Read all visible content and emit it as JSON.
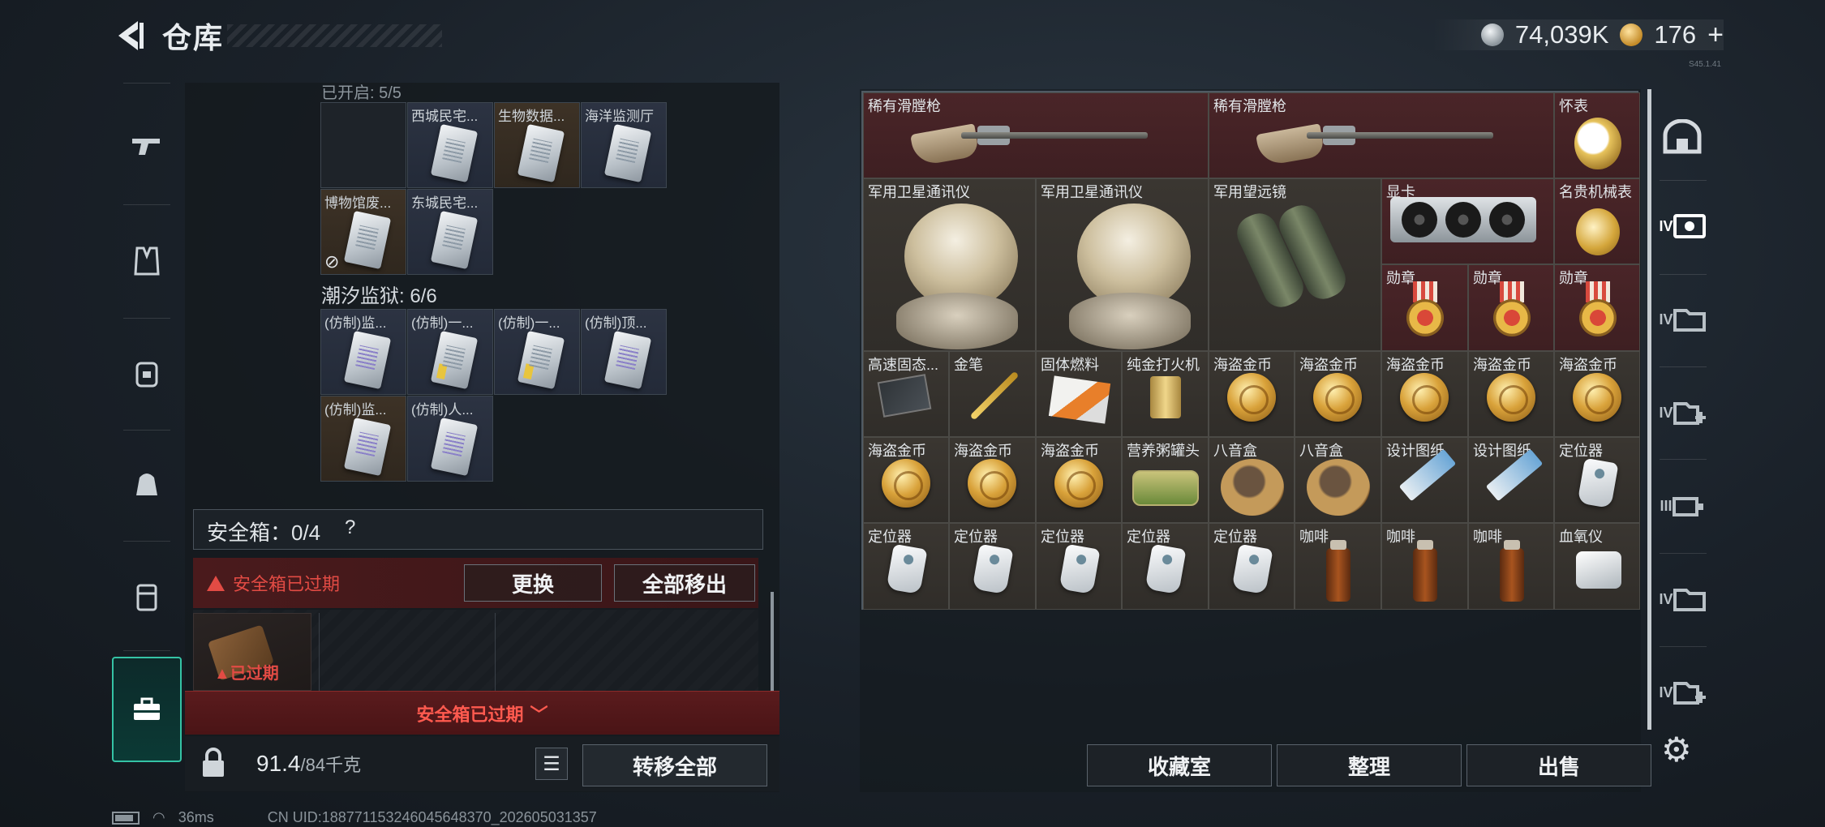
{
  "header": {
    "title": "仓库",
    "silver_amount": "74,039K",
    "gold_amount": "176",
    "gold_add": "+",
    "version_text": "S45.1.41"
  },
  "left_sidebar": {
    "icons": [
      "pistol-icon",
      "vest-icon",
      "backpack-icon",
      "bag-icon",
      "armor-icon",
      "safe-box-icon"
    ],
    "active": "safe-box-icon"
  },
  "left_panel": {
    "cut_label": "已开启: 5/5",
    "group1": [
      {
        "label": "",
        "style": "dark"
      },
      {
        "label": "西城民宅...",
        "style": "blue"
      },
      {
        "label": "生物数据...",
        "style": "brown"
      },
      {
        "label": "海洋监测厅",
        "style": "blue"
      },
      {
        "label": "博物馆废...",
        "style": "brown"
      },
      {
        "label": "东城民宅...",
        "style": "blue"
      }
    ],
    "prison_label": "潮汐监狱: 6/6",
    "group2": [
      {
        "label": "(仿制)监...",
        "style": "blue"
      },
      {
        "label": "(仿制)一...",
        "style": "blue"
      },
      {
        "label": "(仿制)一...",
        "style": "blue"
      },
      {
        "label": "(仿制)顶...",
        "style": "blue"
      },
      {
        "label": "(仿制)监...",
        "style": "brown"
      },
      {
        "label": "(仿制)人...",
        "style": "blue"
      }
    ],
    "safe_box_label": "安全箱：0/4",
    "safe_help": "?",
    "expired_warning": "安全箱已过期",
    "replace_button": "更换",
    "remove_all_button": "全部移出",
    "slot_expired": "已过期",
    "expired_banner": "安全箱已过期",
    "weight_current": "91.4",
    "weight_max": "/84千克",
    "transfer_all": "转移全部"
  },
  "status_bar": {
    "ping": "36ms",
    "uid": "CN UID:188771153246045648370_202605031357"
  },
  "inventory": {
    "rows": [
      [
        "稀有滑膛枪",
        "稀有滑膛枪",
        "怀表"
      ],
      [
        "军用卫星通讯仪",
        "军用卫星通讯仪",
        "军用望远镜",
        "显卡",
        "名贵机械表"
      ],
      [
        "勋章",
        "勋章",
        "勋章"
      ],
      [
        "高速固态...",
        "金笔",
        "固体燃料",
        "纯金打火机",
        "海盗金币",
        "海盗金币",
        "海盗金币",
        "海盗金币",
        "海盗金币"
      ],
      [
        "海盗金币",
        "海盗金币",
        "海盗金币",
        "营养粥罐头",
        "八音盒",
        "八音盒",
        "设计图纸",
        "设计图纸",
        "定位器"
      ],
      [
        "定位器",
        "定位器",
        "定位器",
        "定位器",
        "定位器",
        "咖啡",
        "咖啡",
        "咖啡",
        "血氧仪"
      ]
    ]
  },
  "right_buttons": {
    "collection": "收藏室",
    "organize": "整理",
    "sell": "出售"
  },
  "right_sidebar": {
    "icons": [
      "room-icon",
      "tier4-safe-icon",
      "tier4-folder-icon",
      "tier4-add-icon",
      "tier3-machine-icon",
      "tier4-folder-icon-2",
      "tier4-add-icon-2"
    ],
    "labels": [
      "",
      "IV",
      "IV",
      "IV",
      "III",
      "IV",
      "IV"
    ]
  },
  "colors": {
    "accent_teal": "#35c3a5",
    "alert_red": "#e24b44",
    "rare_red_bg": "#4a2528"
  }
}
